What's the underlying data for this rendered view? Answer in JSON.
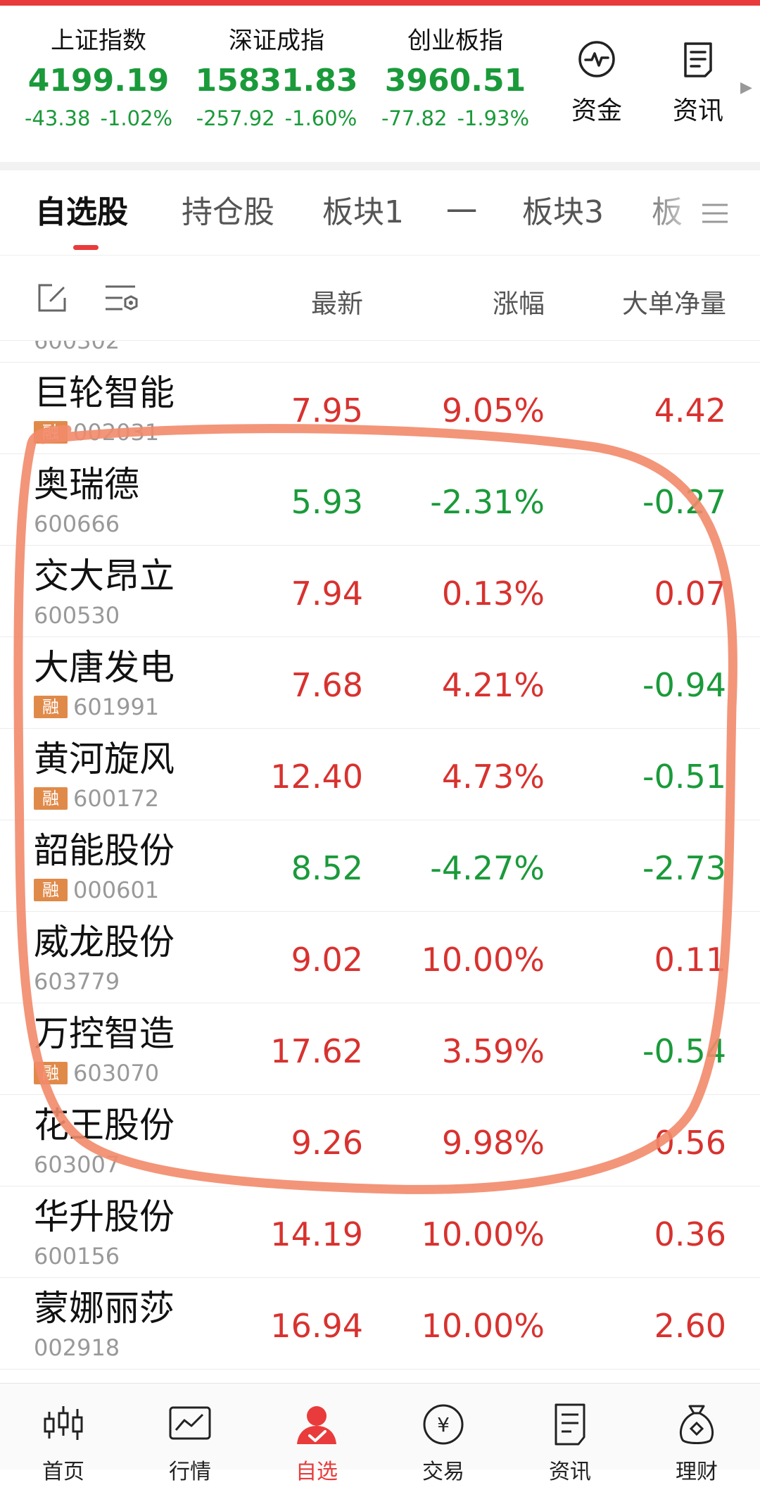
{
  "indices": [
    {
      "name": "上证指数",
      "value": "4199.19",
      "change": "-43.38",
      "pct": "-1.02%"
    },
    {
      "name": "深证成指",
      "value": "15831.83",
      "change": "-257.92",
      "pct": "-1.60%"
    },
    {
      "name": "创业板指",
      "value": "3960.51",
      "change": "-77.82",
      "pct": "-1.93%"
    }
  ],
  "quick_actions": [
    {
      "label": "资金",
      "icon": "pulse-icon"
    },
    {
      "label": "资讯",
      "icon": "document-icon"
    }
  ],
  "tabs": [
    {
      "label": "自选股",
      "active": true
    },
    {
      "label": "持仓股",
      "active": false
    },
    {
      "label": "板块1",
      "active": false
    },
    {
      "label": "一",
      "active": false
    },
    {
      "label": "板块3",
      "active": false
    },
    {
      "label": "板",
      "active": false
    }
  ],
  "columns": {
    "latest": "最新",
    "change": "涨幅",
    "big_order": "大单净量"
  },
  "partial_top_code": "600302",
  "stocks": [
    {
      "name": "巨轮智能",
      "code": "002031",
      "rong": true,
      "price": "7.95",
      "pct": "9.05%",
      "vol": "4.42",
      "price_dir": "up",
      "pct_dir": "up",
      "vol_dir": "up"
    },
    {
      "name": "奥瑞德",
      "code": "600666",
      "rong": false,
      "price": "5.93",
      "pct": "-2.31%",
      "vol": "-0.27",
      "price_dir": "down",
      "pct_dir": "down",
      "vol_dir": "down"
    },
    {
      "name": "交大昂立",
      "code": "600530",
      "rong": false,
      "price": "7.94",
      "pct": "0.13%",
      "vol": "0.07",
      "price_dir": "up",
      "pct_dir": "up",
      "vol_dir": "up"
    },
    {
      "name": "大唐发电",
      "code": "601991",
      "rong": true,
      "price": "7.68",
      "pct": "4.21%",
      "vol": "-0.94",
      "price_dir": "up",
      "pct_dir": "up",
      "vol_dir": "down"
    },
    {
      "name": "黄河旋风",
      "code": "600172",
      "rong": true,
      "price": "12.40",
      "pct": "4.73%",
      "vol": "-0.51",
      "price_dir": "up",
      "pct_dir": "up",
      "vol_dir": "down"
    },
    {
      "name": "韶能股份",
      "code": "000601",
      "rong": true,
      "price": "8.52",
      "pct": "-4.27%",
      "vol": "-2.73",
      "price_dir": "down",
      "pct_dir": "down",
      "vol_dir": "down"
    },
    {
      "name": "威龙股份",
      "code": "603779",
      "rong": false,
      "price": "9.02",
      "pct": "10.00%",
      "vol": "0.11",
      "price_dir": "up",
      "pct_dir": "up",
      "vol_dir": "up"
    },
    {
      "name": "万控智造",
      "code": "603070",
      "rong": true,
      "price": "17.62",
      "pct": "3.59%",
      "vol": "-0.54",
      "price_dir": "up",
      "pct_dir": "up",
      "vol_dir": "down"
    },
    {
      "name": "花王股份",
      "code": "603007",
      "rong": false,
      "price": "9.26",
      "pct": "9.98%",
      "vol": "0.56",
      "price_dir": "up",
      "pct_dir": "up",
      "vol_dir": "up"
    },
    {
      "name": "华升股份",
      "code": "600156",
      "rong": false,
      "price": "14.19",
      "pct": "10.00%",
      "vol": "0.36",
      "price_dir": "up",
      "pct_dir": "up",
      "vol_dir": "up"
    },
    {
      "name": "蒙娜丽莎",
      "code": "002918",
      "rong": false,
      "price": "16.94",
      "pct": "10.00%",
      "vol": "2.60",
      "price_dir": "up",
      "pct_dir": "up",
      "vol_dir": "up"
    }
  ],
  "rong_label": "融",
  "bottom_nav": [
    {
      "label": "首页",
      "icon": "candlestick-icon",
      "active": false
    },
    {
      "label": "行情",
      "icon": "chart-icon",
      "active": false
    },
    {
      "label": "自选",
      "icon": "user-check-icon",
      "active": true
    },
    {
      "label": "交易",
      "icon": "yuan-coin-icon",
      "active": false
    },
    {
      "label": "资讯",
      "icon": "document-icon",
      "active": false
    },
    {
      "label": "理财",
      "icon": "money-bag-icon",
      "active": false
    }
  ],
  "colors": {
    "up": "#d8322f",
    "down": "#1a9a3a",
    "accent": "#e93b3b",
    "rong_badge": "#e08a4a",
    "annotation": "#f28a6a"
  }
}
